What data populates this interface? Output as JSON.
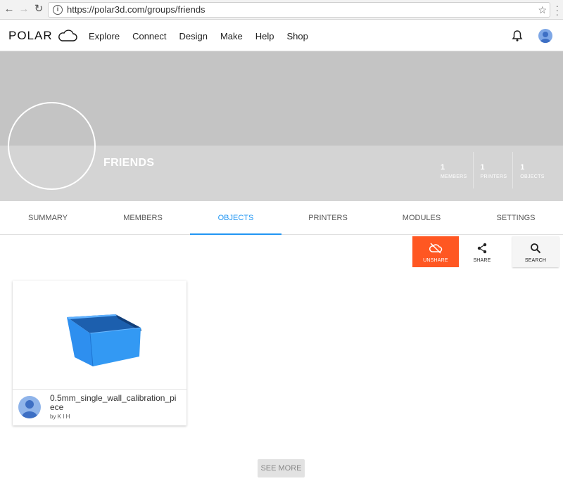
{
  "browser": {
    "url": "https://polar3d.com/groups/friends"
  },
  "app": {
    "logo_text": "POLAR",
    "nav": [
      "Explore",
      "Connect",
      "Design",
      "Make",
      "Help",
      "Shop"
    ]
  },
  "group": {
    "title": "FRIENDS",
    "stats": [
      {
        "value": "1",
        "label": "MEMBERS"
      },
      {
        "value": "1",
        "label": "PRINTERS"
      },
      {
        "value": "1",
        "label": "OBJECTS"
      }
    ]
  },
  "tabs": [
    {
      "label": "SUMMARY",
      "active": false
    },
    {
      "label": "MEMBERS",
      "active": false
    },
    {
      "label": "OBJECTS",
      "active": true
    },
    {
      "label": "PRINTERS",
      "active": false
    },
    {
      "label": "MODULES",
      "active": false
    },
    {
      "label": "SETTINGS",
      "active": false
    }
  ],
  "actions": {
    "unshare": "UNSHARE",
    "share": "SHARE",
    "search": "SEARCH"
  },
  "objects": [
    {
      "name": "0.5mm_single_wall_calibration_piece",
      "by": "by K I H"
    }
  ],
  "see_more": "SEE MORE",
  "colors": {
    "accent": "#2196f3",
    "unshare": "#ff5722",
    "object_blue": "#2b8ff0"
  }
}
